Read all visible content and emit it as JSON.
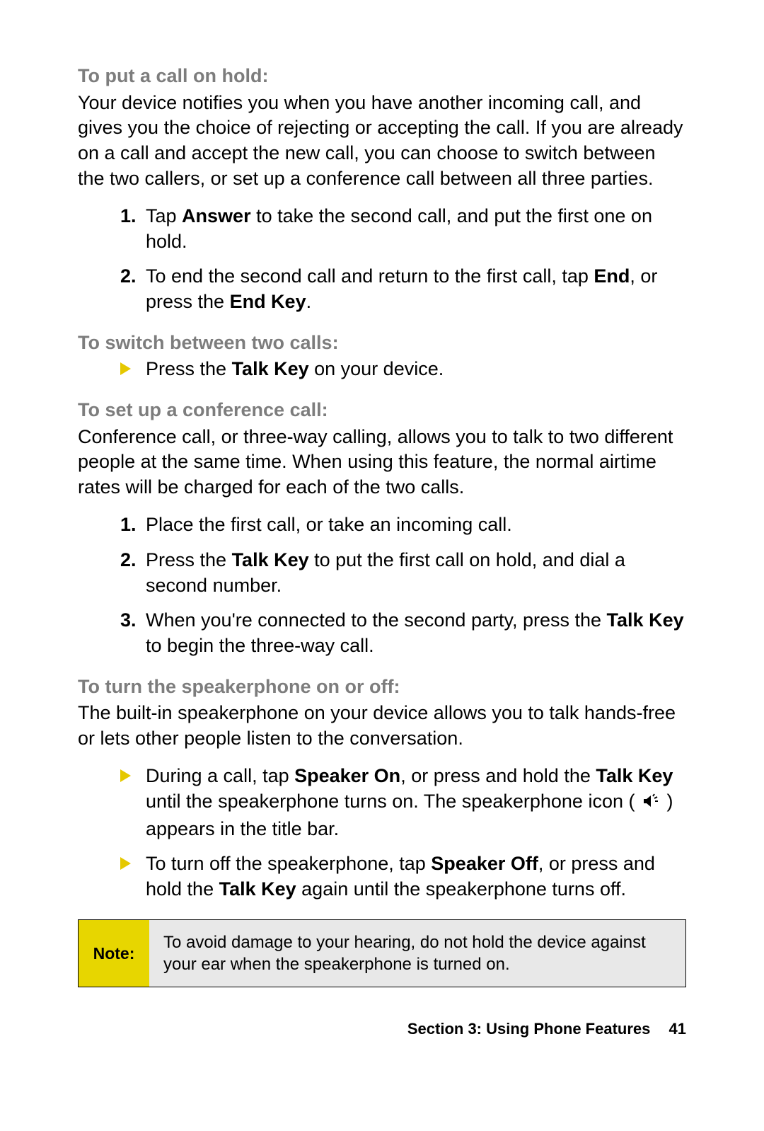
{
  "sections": {
    "hold": {
      "heading": "To put a call on hold:",
      "body": "Your device notifies you when you have another incoming call, and gives you the choice of rejecting or accepting the call. If you are already on a call and accept the new call, you can choose to switch between the two callers, or set up a conference call between all three parties.",
      "steps": [
        {
          "pre": "Tap ",
          "b1": "Answer",
          "post": " to take the second call, and put the first one on hold."
        },
        {
          "pre": "To end the second call and return to the first call, tap ",
          "b1": "End",
          "mid": ", or press the ",
          "b2": "End Key",
          "post": "."
        }
      ]
    },
    "switch": {
      "heading": "To switch between two calls:",
      "bullet": {
        "pre": "Press the ",
        "b1": "Talk Key",
        "post": " on your device."
      }
    },
    "conference": {
      "heading": "To set up a conference call:",
      "body": "Conference call, or three-way calling, allows you to talk to two different people at the same time. When using this feature, the normal airtime rates will be charged for each of the two calls.",
      "steps": [
        {
          "text": "Place the first call, or take an incoming call."
        },
        {
          "pre": "Press the ",
          "b1": "Talk Key",
          "post": " to put the first call on hold, and dial a second number."
        },
        {
          "pre": "When you're connected to the second party, press the ",
          "b1": "Talk Key",
          "post": " to begin the three-way call."
        }
      ]
    },
    "speaker": {
      "heading": "To turn the speakerphone on or off:",
      "body": "The built-in speakerphone on your device allows you to talk hands-free or lets other people listen to the conversation.",
      "bullets": [
        {
          "pre": "During a call, tap ",
          "b1": "Speaker On",
          "mid": ", or press and hold the ",
          "b2": "Talk Key",
          "post1": " until the speakerphone turns on. The speakerphone icon ( ",
          "post2": " ) appears in the title bar."
        },
        {
          "pre": "To turn off the speakerphone, tap ",
          "b1": "Speaker Off",
          "mid": ", or press and hold the ",
          "b2": "Talk Key",
          "post": " again until the speakerphone turns off."
        }
      ]
    }
  },
  "note": {
    "label": "Note:",
    "text": "To avoid damage to your hearing, do not hold the device against your ear when the speakerphone is turned on."
  },
  "footer": {
    "section": "Section 3: Using Phone Features",
    "page": "41"
  }
}
